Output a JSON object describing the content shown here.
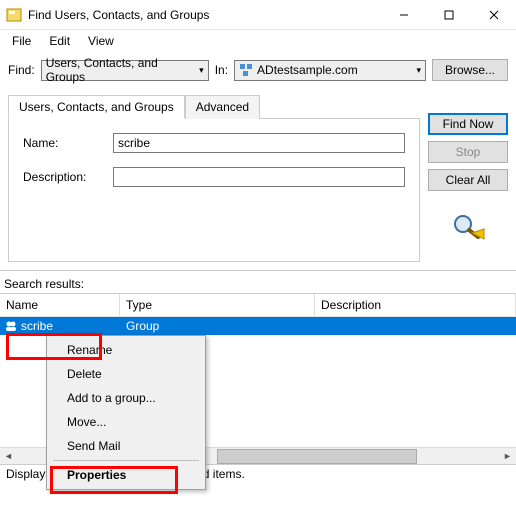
{
  "window": {
    "title": "Find Users, Contacts, and Groups"
  },
  "menu": {
    "file": "File",
    "edit": "Edit",
    "view": "View"
  },
  "findbar": {
    "find_label": "Find:",
    "find_combo": "Users, Contacts, and Groups",
    "in_label": "In:",
    "in_combo": "ADtestsample.com",
    "browse": "Browse..."
  },
  "tabs": {
    "main": "Users, Contacts, and Groups",
    "adv": "Advanced"
  },
  "form": {
    "name_label": "Name:",
    "name_value": "scribe",
    "desc_label": "Description:",
    "desc_value": ""
  },
  "side": {
    "findnow": "Find Now",
    "stop": "Stop",
    "clear": "Clear All"
  },
  "results": {
    "label": "Search results:",
    "cols": {
      "name": "Name",
      "type": "Type",
      "desc": "Description"
    },
    "row": {
      "name": "scribe",
      "type": "Group",
      "desc": ""
    }
  },
  "context": {
    "rename": "Rename",
    "delete": "Delete",
    "addgroup": "Add to a group...",
    "move": "Move...",
    "sendmail": "Send Mail",
    "properties": "Properties"
  },
  "status": "Displays the properties of the selected items."
}
